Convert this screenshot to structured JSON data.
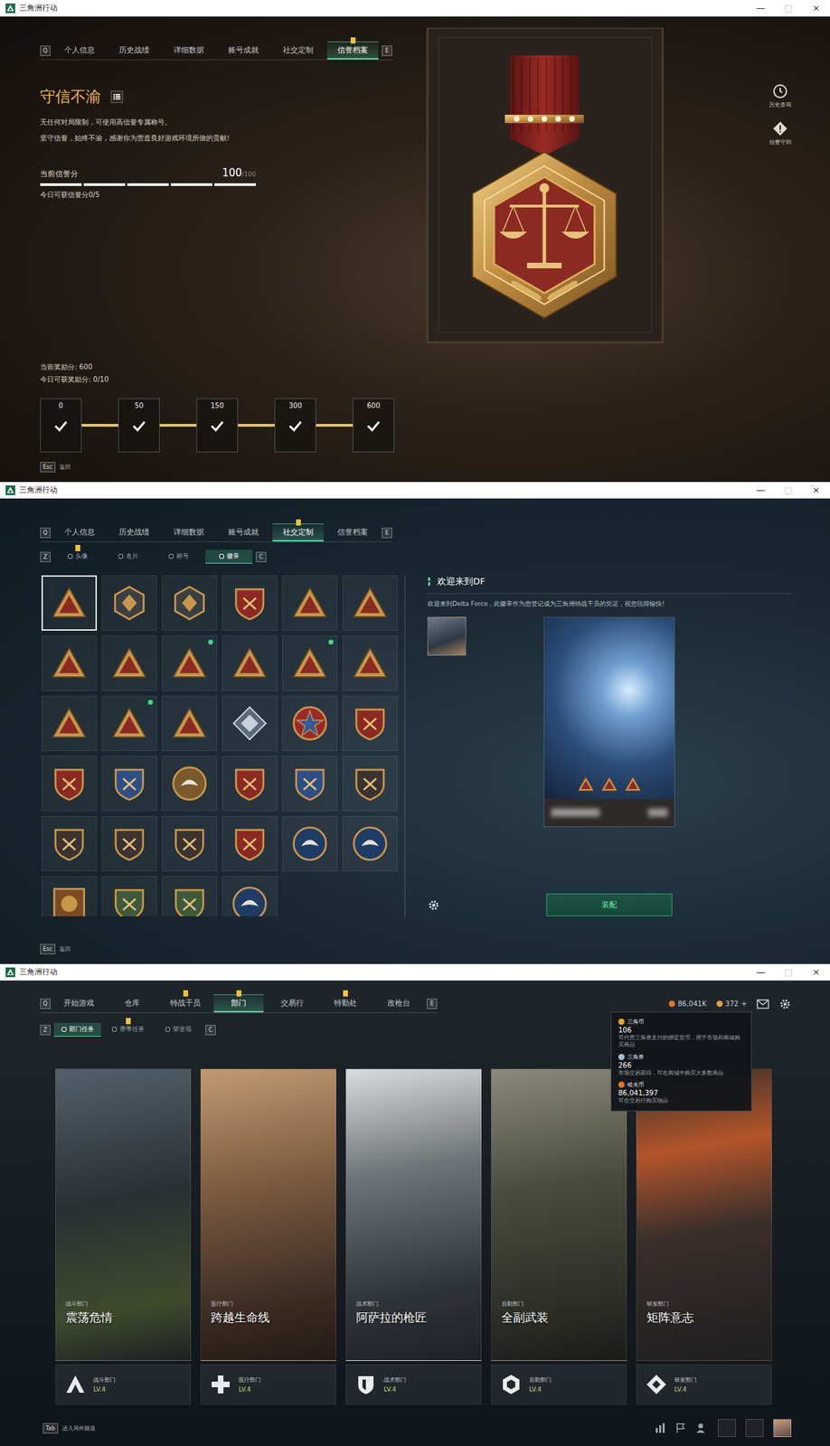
{
  "reputation": {
    "window": {
      "title": "三角洲行动",
      "controls": [
        {
          "label": "—",
          "disabled": false
        },
        {
          "label": "□",
          "disabled": true
        },
        {
          "label": "×",
          "disabled": false
        }
      ]
    },
    "keys": {
      "prev": "Q",
      "next": "E"
    },
    "tabs": [
      {
        "label": "个人信息",
        "selected": false,
        "badge": false
      },
      {
        "label": "历史战绩",
        "selected": false,
        "badge": false
      },
      {
        "label": "详细数据",
        "selected": false,
        "badge": false
      },
      {
        "label": "账号成就",
        "selected": false,
        "badge": false
      },
      {
        "label": "社交定制",
        "selected": false,
        "badge": false
      },
      {
        "label": "信誉档案",
        "selected": true,
        "badge": true
      }
    ],
    "heading": "守信不渝",
    "descriptions": [
      "无任何对局限制，可使用高信誉专属称号。",
      "坚守信誉，始终不渝，感谢你为营造良好游戏环境所做的贡献!"
    ],
    "score": {
      "label": "当前信誉分",
      "value": "100",
      "max": "/100",
      "level": 1
    },
    "daily_score": "今日可获信誉分0/5",
    "reward": "当前奖励分: 600",
    "daily_reward": "今日可获奖励分: 0/10",
    "milestones": [
      {
        "value": "0",
        "claimed": true
      },
      {
        "value": "50",
        "claimed": true
      },
      {
        "value": "150",
        "claimed": true
      },
      {
        "value": "300",
        "claimed": true
      },
      {
        "value": "600",
        "claimed": true
      }
    ],
    "side_buttons": [
      {
        "label": "历史查询"
      },
      {
        "label": "信誉守则"
      }
    ],
    "back": {
      "key": "Esc",
      "label": "返回"
    }
  },
  "badges": {
    "window": {
      "title": "三角洲行动",
      "controls": [
        {
          "label": "—",
          "disabled": false
        },
        {
          "label": "□",
          "disabled": true
        },
        {
          "label": "×",
          "disabled": false
        }
      ]
    },
    "keys": {
      "prev": "Q",
      "next": "E"
    },
    "tabs": [
      {
        "label": "个人信息",
        "selected": false,
        "badge": false
      },
      {
        "label": "历史战绩",
        "selected": false,
        "badge": false
      },
      {
        "label": "详细数据",
        "selected": false,
        "badge": false
      },
      {
        "label": "账号成就",
        "selected": false,
        "badge": false
      },
      {
        "label": "社交定制",
        "selected": true,
        "badge": true
      },
      {
        "label": "信誉档案",
        "selected": false,
        "badge": false
      }
    ],
    "subkeys": {
      "prev": "Z",
      "next": "C"
    },
    "subtabs": [
      {
        "label": "头像",
        "selected": false,
        "badge": true
      },
      {
        "label": "名片",
        "selected": false,
        "badge": false
      },
      {
        "label": "称号",
        "selected": false,
        "badge": false
      },
      {
        "label": "徽章",
        "selected": true,
        "badge": false
      }
    ],
    "items": [
      {
        "selected": true,
        "new": false
      },
      {
        "selected": false,
        "new": false
      },
      {
        "selected": false,
        "new": false
      },
      {
        "selected": false,
        "new": false
      },
      {
        "selected": false,
        "new": false
      },
      {
        "selected": false,
        "new": false
      },
      {
        "selected": false,
        "new": false
      },
      {
        "selected": false,
        "new": false
      },
      {
        "selected": false,
        "new": true
      },
      {
        "selected": false,
        "new": false
      },
      {
        "selected": false,
        "new": true
      },
      {
        "selected": false,
        "new": false
      },
      {
        "selected": false,
        "new": false
      },
      {
        "selected": false,
        "new": true
      },
      {
        "selected": false,
        "new": false
      },
      {
        "selected": false,
        "new": false
      },
      {
        "selected": false,
        "new": false
      },
      {
        "selected": false,
        "new": false
      },
      {
        "selected": false,
        "new": false
      },
      {
        "selected": false,
        "new": false
      },
      {
        "selected": false,
        "new": false
      },
      {
        "selected": false,
        "new": false
      },
      {
        "selected": false,
        "new": false
      },
      {
        "selected": false,
        "new": false
      },
      {
        "selected": false,
        "new": false
      },
      {
        "selected": false,
        "new": false
      },
      {
        "selected": false,
        "new": false
      },
      {
        "selected": false,
        "new": false
      },
      {
        "selected": false,
        "new": false
      },
      {
        "selected": false,
        "new": false
      },
      {
        "selected": false,
        "new": false
      },
      {
        "selected": false,
        "new": false
      },
      {
        "selected": false,
        "new": false
      },
      {
        "selected": false,
        "new": false
      }
    ],
    "detail": {
      "title": "欢迎来到DF",
      "description": "欢迎来到Delta Force，此徽章作为您登记成为三角洲特战干员的凭证，祝您玩得愉快!",
      "equip": "装配"
    },
    "back": {
      "key": "Esc",
      "label": "返回"
    }
  },
  "departments": {
    "window": {
      "title": "三角洲行动",
      "controls": [
        {
          "label": "—",
          "disabled": false
        },
        {
          "label": "□",
          "disabled": true
        },
        {
          "label": "×",
          "disabled": false
        }
      ]
    },
    "keys": {
      "prev": "Q",
      "next": "E"
    },
    "tabs": [
      {
        "label": "开始游戏",
        "selected": false,
        "badge": false
      },
      {
        "label": "仓库",
        "selected": false,
        "badge": false
      },
      {
        "label": "特战干员",
        "selected": false,
        "badge": true
      },
      {
        "label": "部门",
        "selected": true,
        "badge": true
      },
      {
        "label": "交易行",
        "selected": false,
        "badge": false
      },
      {
        "label": "特勤处",
        "selected": false,
        "badge": true
      },
      {
        "label": "改枪台",
        "selected": false,
        "badge": false
      }
    ],
    "currency": [
      {
        "amount": "86,041K",
        "action": ""
      },
      {
        "amount": "372",
        "action": "+"
      }
    ],
    "subkeys": {
      "prev": "Z",
      "next": "C"
    },
    "subtabs": [
      {
        "label": "部门任务",
        "selected": true,
        "badge": false
      },
      {
        "label": "赛季任务",
        "selected": false,
        "badge": true
      },
      {
        "label": "荣誉墙",
        "selected": false,
        "badge": false
      }
    ],
    "tooltip": [
      {
        "name": "三角币",
        "amount": "106",
        "description": "可代替三角券支付的绑定货币，用于市场和商城购买商品",
        "color": "#e0a23a"
      },
      {
        "name": "三角券",
        "amount": "266",
        "description": "市场交易获得，可在商城中购买大多数商品",
        "color": "#a9bccd"
      },
      {
        "name": "哈夫币",
        "amount": "86,041,397",
        "description": "可在交易行购买物品",
        "color": "#e0782a"
      }
    ],
    "cards": [
      {
        "department": "战斗部门",
        "title": "震荡危情",
        "level": "LV.4"
      },
      {
        "department": "医疗部门",
        "title": "跨越生命线",
        "level": "LV.4"
      },
      {
        "department": "战术部门",
        "title": "阿萨拉的枪匠",
        "level": "LV.4"
      },
      {
        "department": "后勤部门",
        "title": "全副武装",
        "level": "LV.4"
      },
      {
        "department": "研发部门",
        "title": "矩阵意志",
        "level": "LV.4"
      }
    ],
    "chat": {
      "key": "Tab",
      "label": "进入局外频道"
    }
  }
}
